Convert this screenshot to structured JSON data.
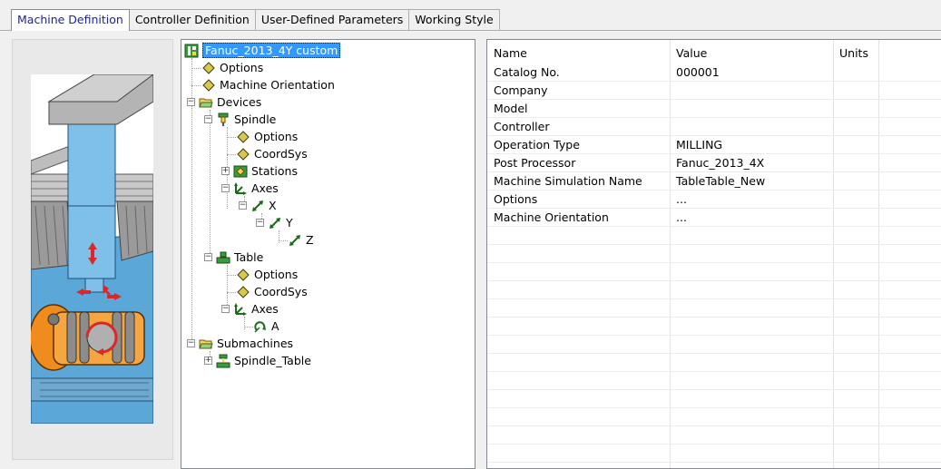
{
  "tabs": [
    {
      "label": "Machine Definition",
      "active": true
    },
    {
      "label": "Controller Definition",
      "active": false
    },
    {
      "label": "User-Defined Parameters",
      "active": false
    },
    {
      "label": "Working Style",
      "active": false
    }
  ],
  "tree": {
    "root": "Fanuc_2013_4Y custom",
    "options": "Options",
    "machine_orientation": "Machine Orientation",
    "devices": "Devices",
    "spindle": "Spindle",
    "spindle_options": "Options",
    "spindle_coordsys": "CoordSys",
    "stations": "Stations",
    "spindle_axes": "Axes",
    "axis_x": "X",
    "axis_y": "Y",
    "axis_z": "Z",
    "table": "Table",
    "table_options": "Options",
    "table_coordsys": "CoordSys",
    "table_axes": "Axes",
    "axis_a": "A",
    "submachines": "Submachines",
    "spindle_table": "Spindle_Table"
  },
  "grid": {
    "headers": {
      "name": "Name",
      "value": "Value",
      "units": "Units"
    },
    "rows": [
      {
        "name": "Catalog No.",
        "value": "000001",
        "units": ""
      },
      {
        "name": "Company",
        "value": "",
        "units": ""
      },
      {
        "name": "Model",
        "value": "",
        "units": ""
      },
      {
        "name": "Controller",
        "value": "",
        "units": ""
      },
      {
        "name": "Operation Type",
        "value": "MILLING",
        "units": ""
      },
      {
        "name": "Post Processor",
        "value": "Fanuc_2013_4X",
        "units": ""
      },
      {
        "name": "Machine Simulation Name",
        "value": "TableTable_New",
        "units": ""
      },
      {
        "name": "Options",
        "value": "...",
        "units": ""
      },
      {
        "name": "Machine Orientation",
        "value": "...",
        "units": ""
      }
    ]
  },
  "colors": {
    "selection": "#3399ff",
    "active_tab_text": "#1e1ea0",
    "machine_blue": "#7fc0e8",
    "machine_orange": "#f08c1e",
    "arrow_red": "#d8282a"
  }
}
